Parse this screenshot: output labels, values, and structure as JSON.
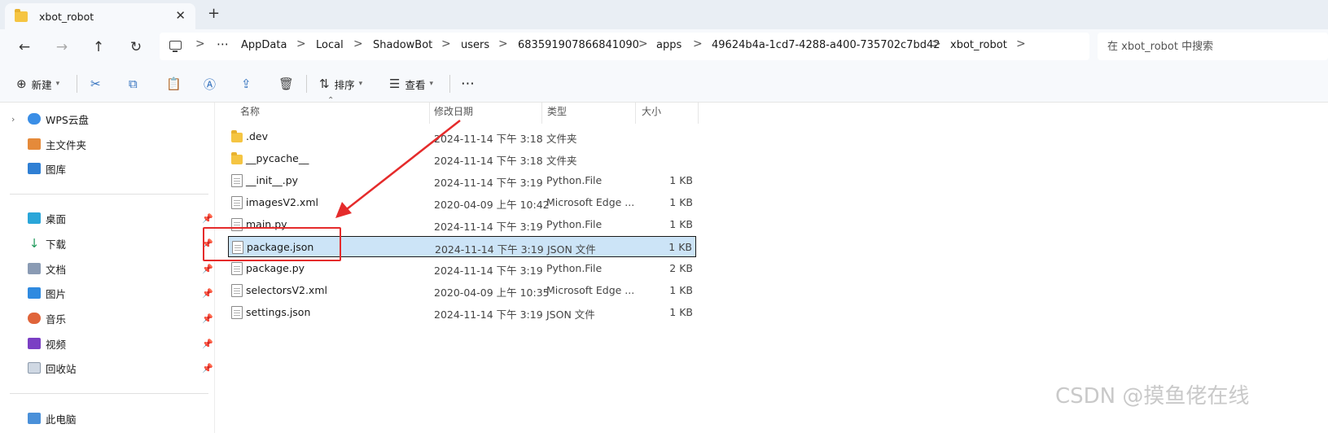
{
  "tab": {
    "title": "xbot_robot",
    "close_glyph": "✕",
    "new_tab_glyph": "+"
  },
  "nav": {
    "back": "←",
    "forward": "→",
    "up": "↑",
    "refresh": "↻"
  },
  "breadcrumb": {
    "more": "⋯",
    "items": [
      "AppData",
      "Local",
      "ShadowBot",
      "users",
      "683591907866841090",
      "apps",
      "49624b4a-1cd7-4288-a400-735702c7bd42",
      "xbot_robot"
    ],
    "separator": ">"
  },
  "search": {
    "placeholder": "在 xbot_robot 中搜索"
  },
  "toolbar": {
    "new_label": "新建",
    "sort_label": "排序",
    "view_label": "查看",
    "more": "⋯",
    "icons": [
      "cut-icon",
      "copy-icon",
      "paste-icon",
      "rename-icon",
      "share-icon",
      "delete-icon"
    ]
  },
  "sidebar": {
    "top_items": [
      {
        "label": "WPS云盘",
        "icon": "cloud-icon"
      },
      {
        "label": "主文件夹",
        "icon": "home-icon"
      },
      {
        "label": "图库",
        "icon": "gallery-icon"
      }
    ],
    "pinned_items": [
      {
        "label": "桌面",
        "icon": "desktop-icon"
      },
      {
        "label": "下载",
        "icon": "download-icon"
      },
      {
        "label": "文档",
        "icon": "document-icon"
      },
      {
        "label": "图片",
        "icon": "picture-icon"
      },
      {
        "label": "音乐",
        "icon": "music-icon"
      },
      {
        "label": "视频",
        "icon": "video-icon"
      },
      {
        "label": "回收站",
        "icon": "recycle-bin-icon"
      }
    ],
    "bottom_partial": "此电脑"
  },
  "columns": {
    "name": "名称",
    "date": "修改日期",
    "type": "类型",
    "size": "大小"
  },
  "files": [
    {
      "name": ".dev",
      "date": "2024-11-14 下午 3:18",
      "type": "文件夹",
      "size": "",
      "kind": "folder"
    },
    {
      "name": "__pycache__",
      "date": "2024-11-14 下午 3:18",
      "type": "文件夹",
      "size": "",
      "kind": "folder"
    },
    {
      "name": "__init__.py",
      "date": "2024-11-14 下午 3:19",
      "type": "Python.File",
      "size": "1 KB",
      "kind": "file"
    },
    {
      "name": "imagesV2.xml",
      "date": "2020-04-09 上午 10:42",
      "type": "Microsoft Edge ...",
      "size": "1 KB",
      "kind": "file"
    },
    {
      "name": "main.py",
      "date": "2024-11-14 下午 3:19",
      "type": "Python.File",
      "size": "1 KB",
      "kind": "file"
    },
    {
      "name": "package.json",
      "date": "2024-11-14 下午 3:19",
      "type": "JSON 文件",
      "size": "1 KB",
      "kind": "file",
      "selected": true
    },
    {
      "name": "package.py",
      "date": "2024-11-14 下午 3:19",
      "type": "Python.File",
      "size": "2 KB",
      "kind": "file"
    },
    {
      "name": "selectorsV2.xml",
      "date": "2020-04-09 上午 10:35",
      "type": "Microsoft Edge ...",
      "size": "1 KB",
      "kind": "file"
    },
    {
      "name": "settings.json",
      "date": "2024-11-14 下午 3:19",
      "type": "JSON 文件",
      "size": "1 KB",
      "kind": "file"
    }
  ],
  "annotation_color": "#e52b2b",
  "selection_color": "#cce4f7",
  "watermark": "CSDN @摸鱼佬在线"
}
